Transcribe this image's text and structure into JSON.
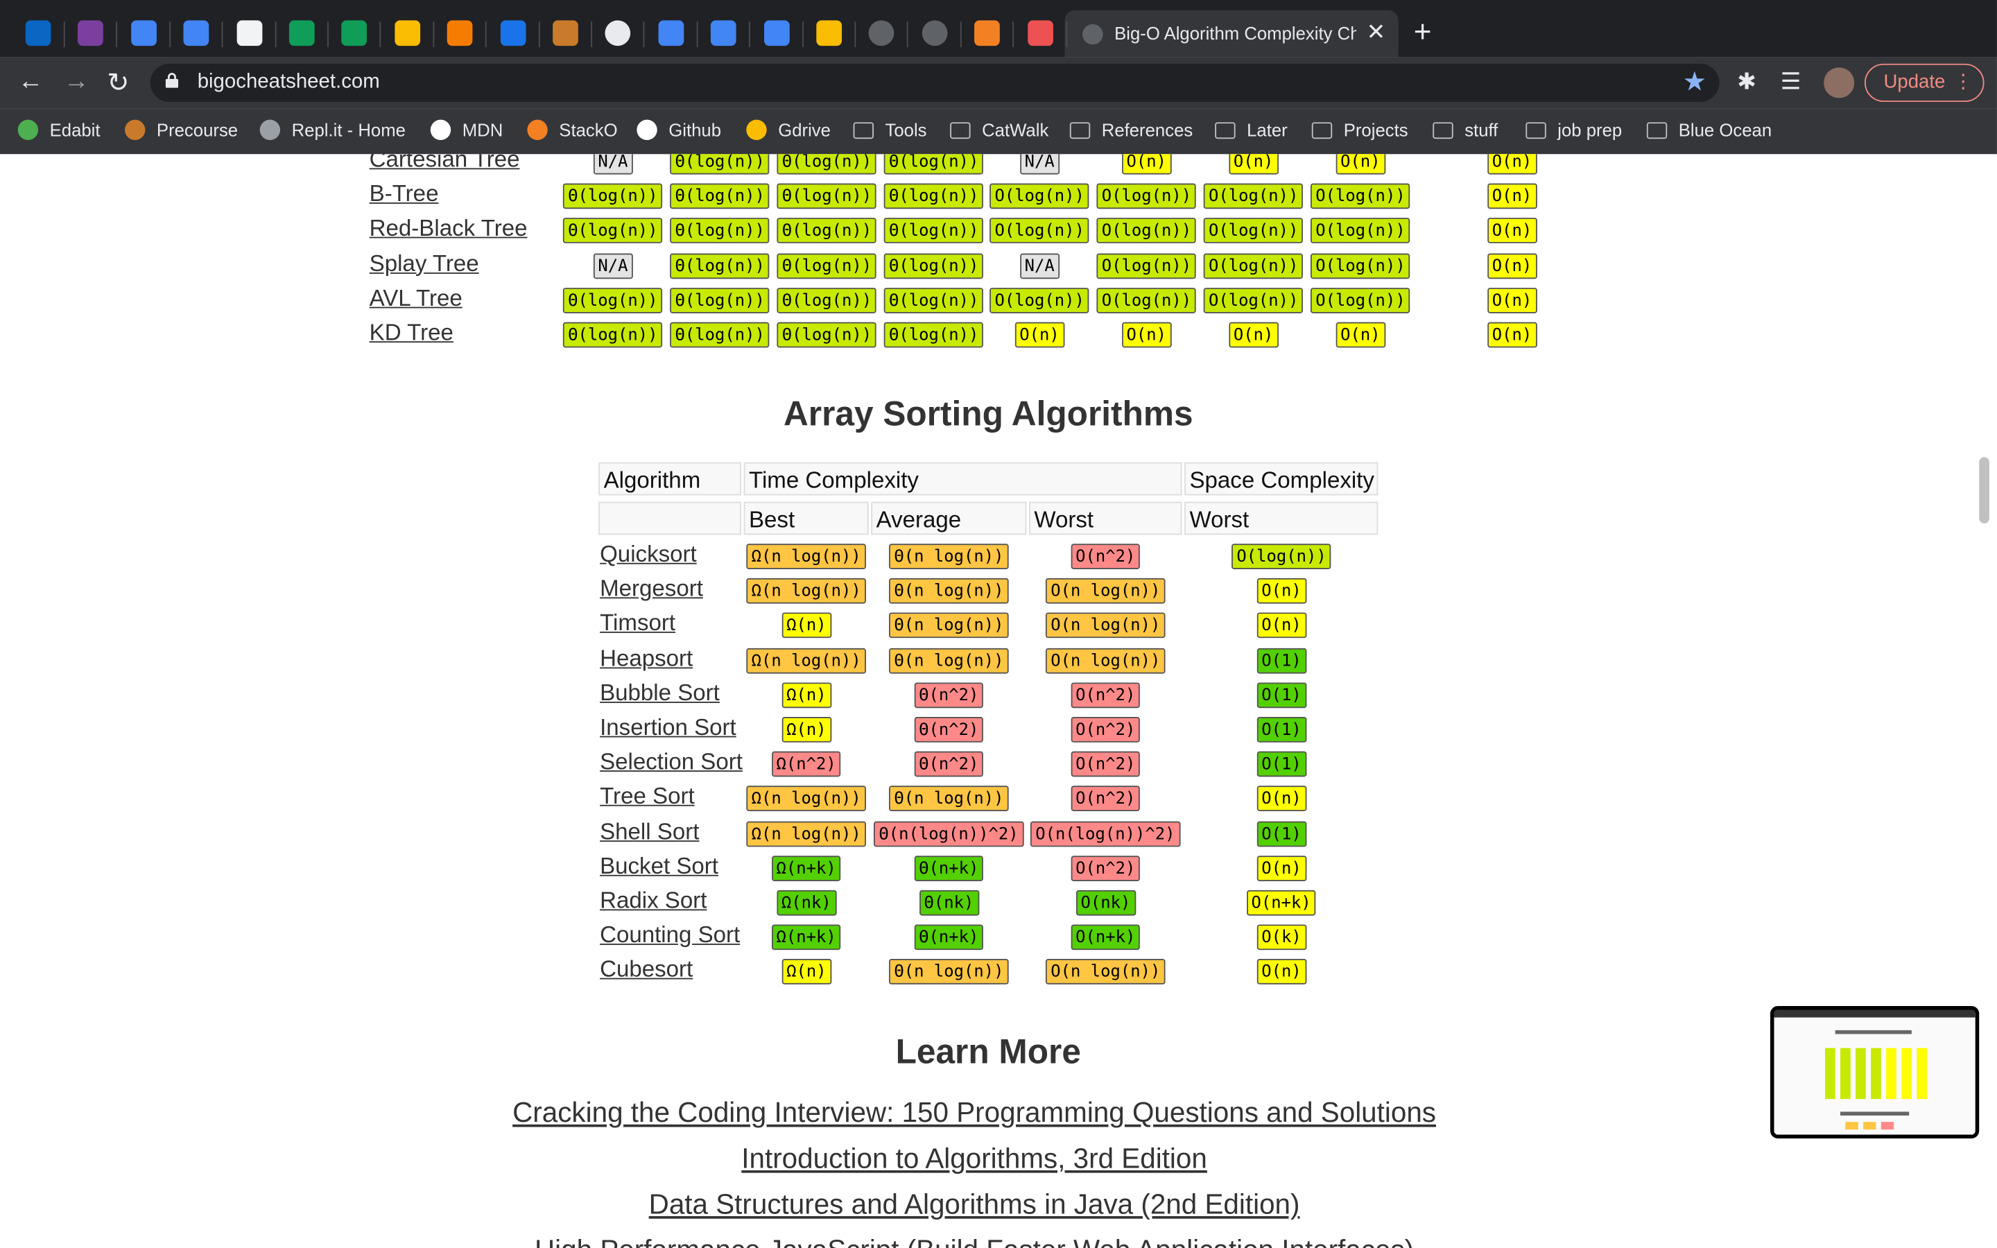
{
  "colors": {
    "excellent": "#53d000",
    "good": "#c8ea00",
    "fair": "#ffff00",
    "bad": "#ffc543",
    "horrible": "#ff8989",
    "na": "#e3e3e3"
  },
  "browser": {
    "tab_icons": [
      "linkedin-icon",
      "color-wheel-icon",
      "calendar-icon",
      "docs-icon",
      "slides-icon",
      "sheets-icon",
      "sheets-icon",
      "drive-icon",
      "package-icon",
      "shield-icon",
      "hand-icon",
      "github-icon",
      "docs-icon",
      "docs-icon",
      "docs-icon",
      "drive-icon",
      "globe-icon",
      "globe-icon",
      "stackoverflow-icon",
      "udemy-icon"
    ],
    "active_tab_title": "Big-O Algorithm Complexity Ch",
    "url": "bigocheatsheet.com",
    "update_label": "Update",
    "bookmarks": [
      {
        "label": "Edabit",
        "icon": "edabit-icon"
      },
      {
        "label": "Precourse",
        "icon": "hand-icon"
      },
      {
        "label": "Repl.it - Home",
        "icon": "replit-icon"
      },
      {
        "label": "MDN",
        "icon": "mdn-icon"
      },
      {
        "label": "StackO",
        "icon": "stackoverflow-icon"
      },
      {
        "label": "Github",
        "icon": "github-icon"
      },
      {
        "label": "Gdrive",
        "icon": "drive-icon"
      },
      {
        "label": "Tools",
        "icon": "folder-icon"
      },
      {
        "label": "CatWalk",
        "icon": "folder-icon"
      },
      {
        "label": "References",
        "icon": "folder-icon"
      },
      {
        "label": "Later",
        "icon": "folder-icon"
      },
      {
        "label": "Projects",
        "icon": "folder-icon"
      },
      {
        "label": "stuff",
        "icon": "folder-icon"
      },
      {
        "label": "job prep",
        "icon": "folder-icon"
      },
      {
        "label": "Blue Ocean",
        "icon": "folder-icon"
      }
    ]
  },
  "data_structures": {
    "rows": [
      {
        "name": "Cartesian Tree",
        "cells": [
          [
            "N/A",
            "na"
          ],
          [
            "Θ(log(n))",
            "good"
          ],
          [
            "Θ(log(n))",
            "good"
          ],
          [
            "Θ(log(n))",
            "good"
          ],
          [
            "N/A",
            "na"
          ],
          [
            "O(n)",
            "fair"
          ],
          [
            "O(n)",
            "fair"
          ],
          [
            "O(n)",
            "fair"
          ],
          [
            "O(n)",
            "fair"
          ]
        ]
      },
      {
        "name": "B-Tree",
        "cells": [
          [
            "Θ(log(n))",
            "good"
          ],
          [
            "Θ(log(n))",
            "good"
          ],
          [
            "Θ(log(n))",
            "good"
          ],
          [
            "Θ(log(n))",
            "good"
          ],
          [
            "O(log(n))",
            "good"
          ],
          [
            "O(log(n))",
            "good"
          ],
          [
            "O(log(n))",
            "good"
          ],
          [
            "O(log(n))",
            "good"
          ],
          [
            "O(n)",
            "fair"
          ]
        ]
      },
      {
        "name": "Red-Black Tree",
        "cells": [
          [
            "Θ(log(n))",
            "good"
          ],
          [
            "Θ(log(n))",
            "good"
          ],
          [
            "Θ(log(n))",
            "good"
          ],
          [
            "Θ(log(n))",
            "good"
          ],
          [
            "O(log(n))",
            "good"
          ],
          [
            "O(log(n))",
            "good"
          ],
          [
            "O(log(n))",
            "good"
          ],
          [
            "O(log(n))",
            "good"
          ],
          [
            "O(n)",
            "fair"
          ]
        ]
      },
      {
        "name": "Splay Tree",
        "cells": [
          [
            "N/A",
            "na"
          ],
          [
            "Θ(log(n))",
            "good"
          ],
          [
            "Θ(log(n))",
            "good"
          ],
          [
            "Θ(log(n))",
            "good"
          ],
          [
            "N/A",
            "na"
          ],
          [
            "O(log(n))",
            "good"
          ],
          [
            "O(log(n))",
            "good"
          ],
          [
            "O(log(n))",
            "good"
          ],
          [
            "O(n)",
            "fair"
          ]
        ]
      },
      {
        "name": "AVL Tree",
        "cells": [
          [
            "Θ(log(n))",
            "good"
          ],
          [
            "Θ(log(n))",
            "good"
          ],
          [
            "Θ(log(n))",
            "good"
          ],
          [
            "Θ(log(n))",
            "good"
          ],
          [
            "O(log(n))",
            "good"
          ],
          [
            "O(log(n))",
            "good"
          ],
          [
            "O(log(n))",
            "good"
          ],
          [
            "O(log(n))",
            "good"
          ],
          [
            "O(n)",
            "fair"
          ]
        ]
      },
      {
        "name": "KD Tree",
        "cells": [
          [
            "Θ(log(n))",
            "good"
          ],
          [
            "Θ(log(n))",
            "good"
          ],
          [
            "Θ(log(n))",
            "good"
          ],
          [
            "Θ(log(n))",
            "good"
          ],
          [
            "O(n)",
            "fair"
          ],
          [
            "O(n)",
            "fair"
          ],
          [
            "O(n)",
            "fair"
          ],
          [
            "O(n)",
            "fair"
          ],
          [
            "O(n)",
            "fair"
          ]
        ]
      }
    ]
  },
  "sorting": {
    "title": "Array Sorting Algorithms",
    "headers": {
      "algorithm": "Algorithm",
      "time": "Time Complexity",
      "space": "Space Complexity",
      "best": "Best",
      "average": "Average",
      "worst": "Worst",
      "space_worst": "Worst"
    },
    "rows": [
      {
        "name": "Quicksort",
        "best": [
          "Ω(n log(n))",
          "bad"
        ],
        "average": [
          "Θ(n log(n))",
          "bad"
        ],
        "worst": [
          "O(n^2)",
          "horrible"
        ],
        "space": [
          "O(log(n))",
          "good"
        ]
      },
      {
        "name": "Mergesort",
        "best": [
          "Ω(n log(n))",
          "bad"
        ],
        "average": [
          "Θ(n log(n))",
          "bad"
        ],
        "worst": [
          "O(n log(n))",
          "bad"
        ],
        "space": [
          "O(n)",
          "fair"
        ]
      },
      {
        "name": "Timsort",
        "best": [
          "Ω(n)",
          "fair"
        ],
        "average": [
          "Θ(n log(n))",
          "bad"
        ],
        "worst": [
          "O(n log(n))",
          "bad"
        ],
        "space": [
          "O(n)",
          "fair"
        ]
      },
      {
        "name": "Heapsort",
        "best": [
          "Ω(n log(n))",
          "bad"
        ],
        "average": [
          "Θ(n log(n))",
          "bad"
        ],
        "worst": [
          "O(n log(n))",
          "bad"
        ],
        "space": [
          "O(1)",
          "excellent"
        ]
      },
      {
        "name": "Bubble Sort",
        "best": [
          "Ω(n)",
          "fair"
        ],
        "average": [
          "Θ(n^2)",
          "horrible"
        ],
        "worst": [
          "O(n^2)",
          "horrible"
        ],
        "space": [
          "O(1)",
          "excellent"
        ]
      },
      {
        "name": "Insertion Sort",
        "best": [
          "Ω(n)",
          "fair"
        ],
        "average": [
          "Θ(n^2)",
          "horrible"
        ],
        "worst": [
          "O(n^2)",
          "horrible"
        ],
        "space": [
          "O(1)",
          "excellent"
        ]
      },
      {
        "name": "Selection Sort",
        "best": [
          "Ω(n^2)",
          "horrible"
        ],
        "average": [
          "Θ(n^2)",
          "horrible"
        ],
        "worst": [
          "O(n^2)",
          "horrible"
        ],
        "space": [
          "O(1)",
          "excellent"
        ]
      },
      {
        "name": "Tree Sort",
        "best": [
          "Ω(n log(n))",
          "bad"
        ],
        "average": [
          "Θ(n log(n))",
          "bad"
        ],
        "worst": [
          "O(n^2)",
          "horrible"
        ],
        "space": [
          "O(n)",
          "fair"
        ]
      },
      {
        "name": "Shell Sort",
        "best": [
          "Ω(n log(n))",
          "bad"
        ],
        "average": [
          "Θ(n(log(n))^2)",
          "horrible"
        ],
        "worst": [
          "O(n(log(n))^2)",
          "horrible"
        ],
        "space": [
          "O(1)",
          "excellent"
        ]
      },
      {
        "name": "Bucket Sort",
        "best": [
          "Ω(n+k)",
          "excellent"
        ],
        "average": [
          "Θ(n+k)",
          "excellent"
        ],
        "worst": [
          "O(n^2)",
          "horrible"
        ],
        "space": [
          "O(n)",
          "fair"
        ]
      },
      {
        "name": "Radix Sort",
        "best": [
          "Ω(nk)",
          "excellent"
        ],
        "average": [
          "Θ(nk)",
          "excellent"
        ],
        "worst": [
          "O(nk)",
          "excellent"
        ],
        "space": [
          "O(n+k)",
          "fair"
        ]
      },
      {
        "name": "Counting Sort",
        "best": [
          "Ω(n+k)",
          "excellent"
        ],
        "average": [
          "Θ(n+k)",
          "excellent"
        ],
        "worst": [
          "O(n+k)",
          "excellent"
        ],
        "space": [
          "O(k)",
          "fair"
        ]
      },
      {
        "name": "Cubesort",
        "best": [
          "Ω(n)",
          "fair"
        ],
        "average": [
          "Θ(n log(n))",
          "bad"
        ],
        "worst": [
          "O(n log(n))",
          "bad"
        ],
        "space": [
          "O(n)",
          "fair"
        ]
      }
    ]
  },
  "learn_more": {
    "title": "Learn More",
    "books": [
      "Cracking the Coding Interview: 150 Programming Questions and Solutions",
      "Introduction to Algorithms, 3rd Edition",
      "Data Structures and Algorithms in Java (2nd Edition)",
      "High Performance JavaScript (Build Faster Web Application Interfaces)"
    ]
  }
}
